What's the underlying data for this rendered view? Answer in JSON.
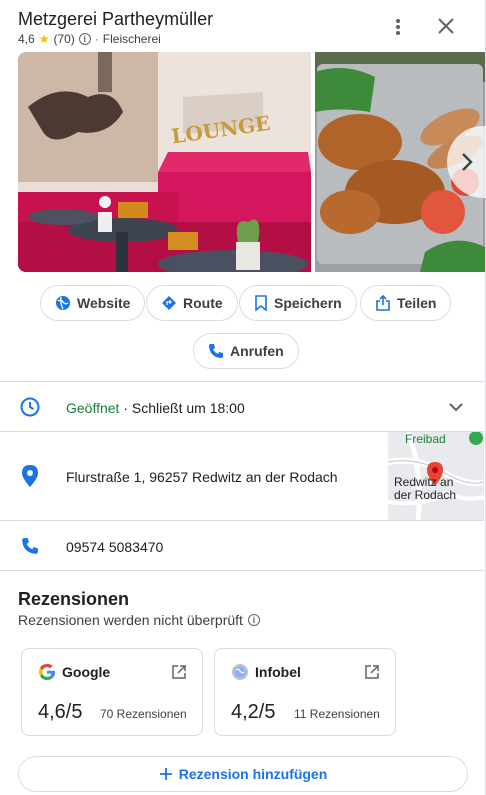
{
  "place": {
    "name": "Metzgerei Partheymüller",
    "rating": "4,6",
    "star": "★",
    "reviews_count": "(70)",
    "info_glyph": "i",
    "separator": "·",
    "category": "Fleischerei"
  },
  "photos": {
    "photo1_sign_text": "LOUNGE"
  },
  "actions": {
    "website": "Website",
    "route": "Route",
    "save": "Speichern",
    "share": "Teilen",
    "call": "Anrufen"
  },
  "hours": {
    "status": "Geöffnet",
    "detail": " · Schließt um 18:00"
  },
  "address": {
    "text": "Flurstraße 1, 96257 Redwitz an der Rodach",
    "map_label_1": "Freibad",
    "map_label_2a": "Redwitz an",
    "map_label_2b": "der Rodach"
  },
  "phone": {
    "number": "09574 5083470"
  },
  "reviews": {
    "title": "Rezensionen",
    "subtitle": "Rezensionen werden nicht überprüft",
    "sources": [
      {
        "name": "Google",
        "score": "4,6/5",
        "count": "70 Rezensionen"
      },
      {
        "name": "Infobel",
        "score": "4,2/5",
        "count": "11 Rezensionen"
      }
    ],
    "add_label": "Rezension hinzufügen"
  },
  "colors": {
    "accent": "#1a73e8",
    "open_green": "#188038",
    "star": "#fbbc04"
  }
}
